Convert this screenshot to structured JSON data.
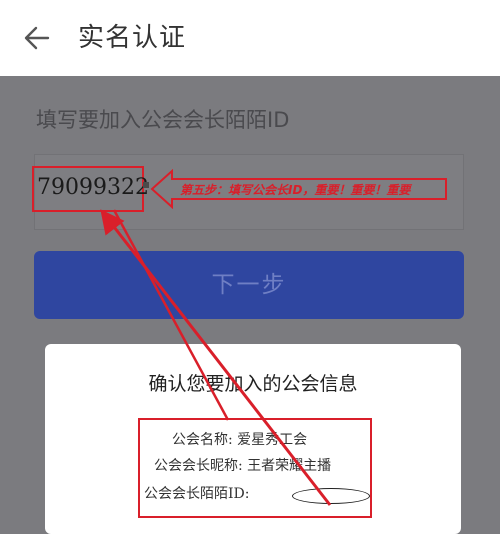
{
  "header": {
    "back_icon": "arrow-left-icon",
    "title": "实名认证"
  },
  "form": {
    "label": "填写要加入公会会长陌陌ID",
    "id_value": "79099322"
  },
  "annotation": {
    "callout_text": "第五步：填写公会长ID，重要！重要！重要"
  },
  "next_button": {
    "label": "下一步"
  },
  "dialog": {
    "title": "确认您要加入的公会信息",
    "guild_name_label": "公会名称: 爱星秀工会",
    "leader_nickname_label": "公会会长昵称: 王者荣耀主播",
    "leader_id_label": "公会会长陌陌ID:"
  },
  "colors": {
    "header_bg": "#ffffff",
    "overlay_bg": "#7b7b7f",
    "primary_button": "#2f46a0",
    "annotation_red": "#d91f2a"
  }
}
